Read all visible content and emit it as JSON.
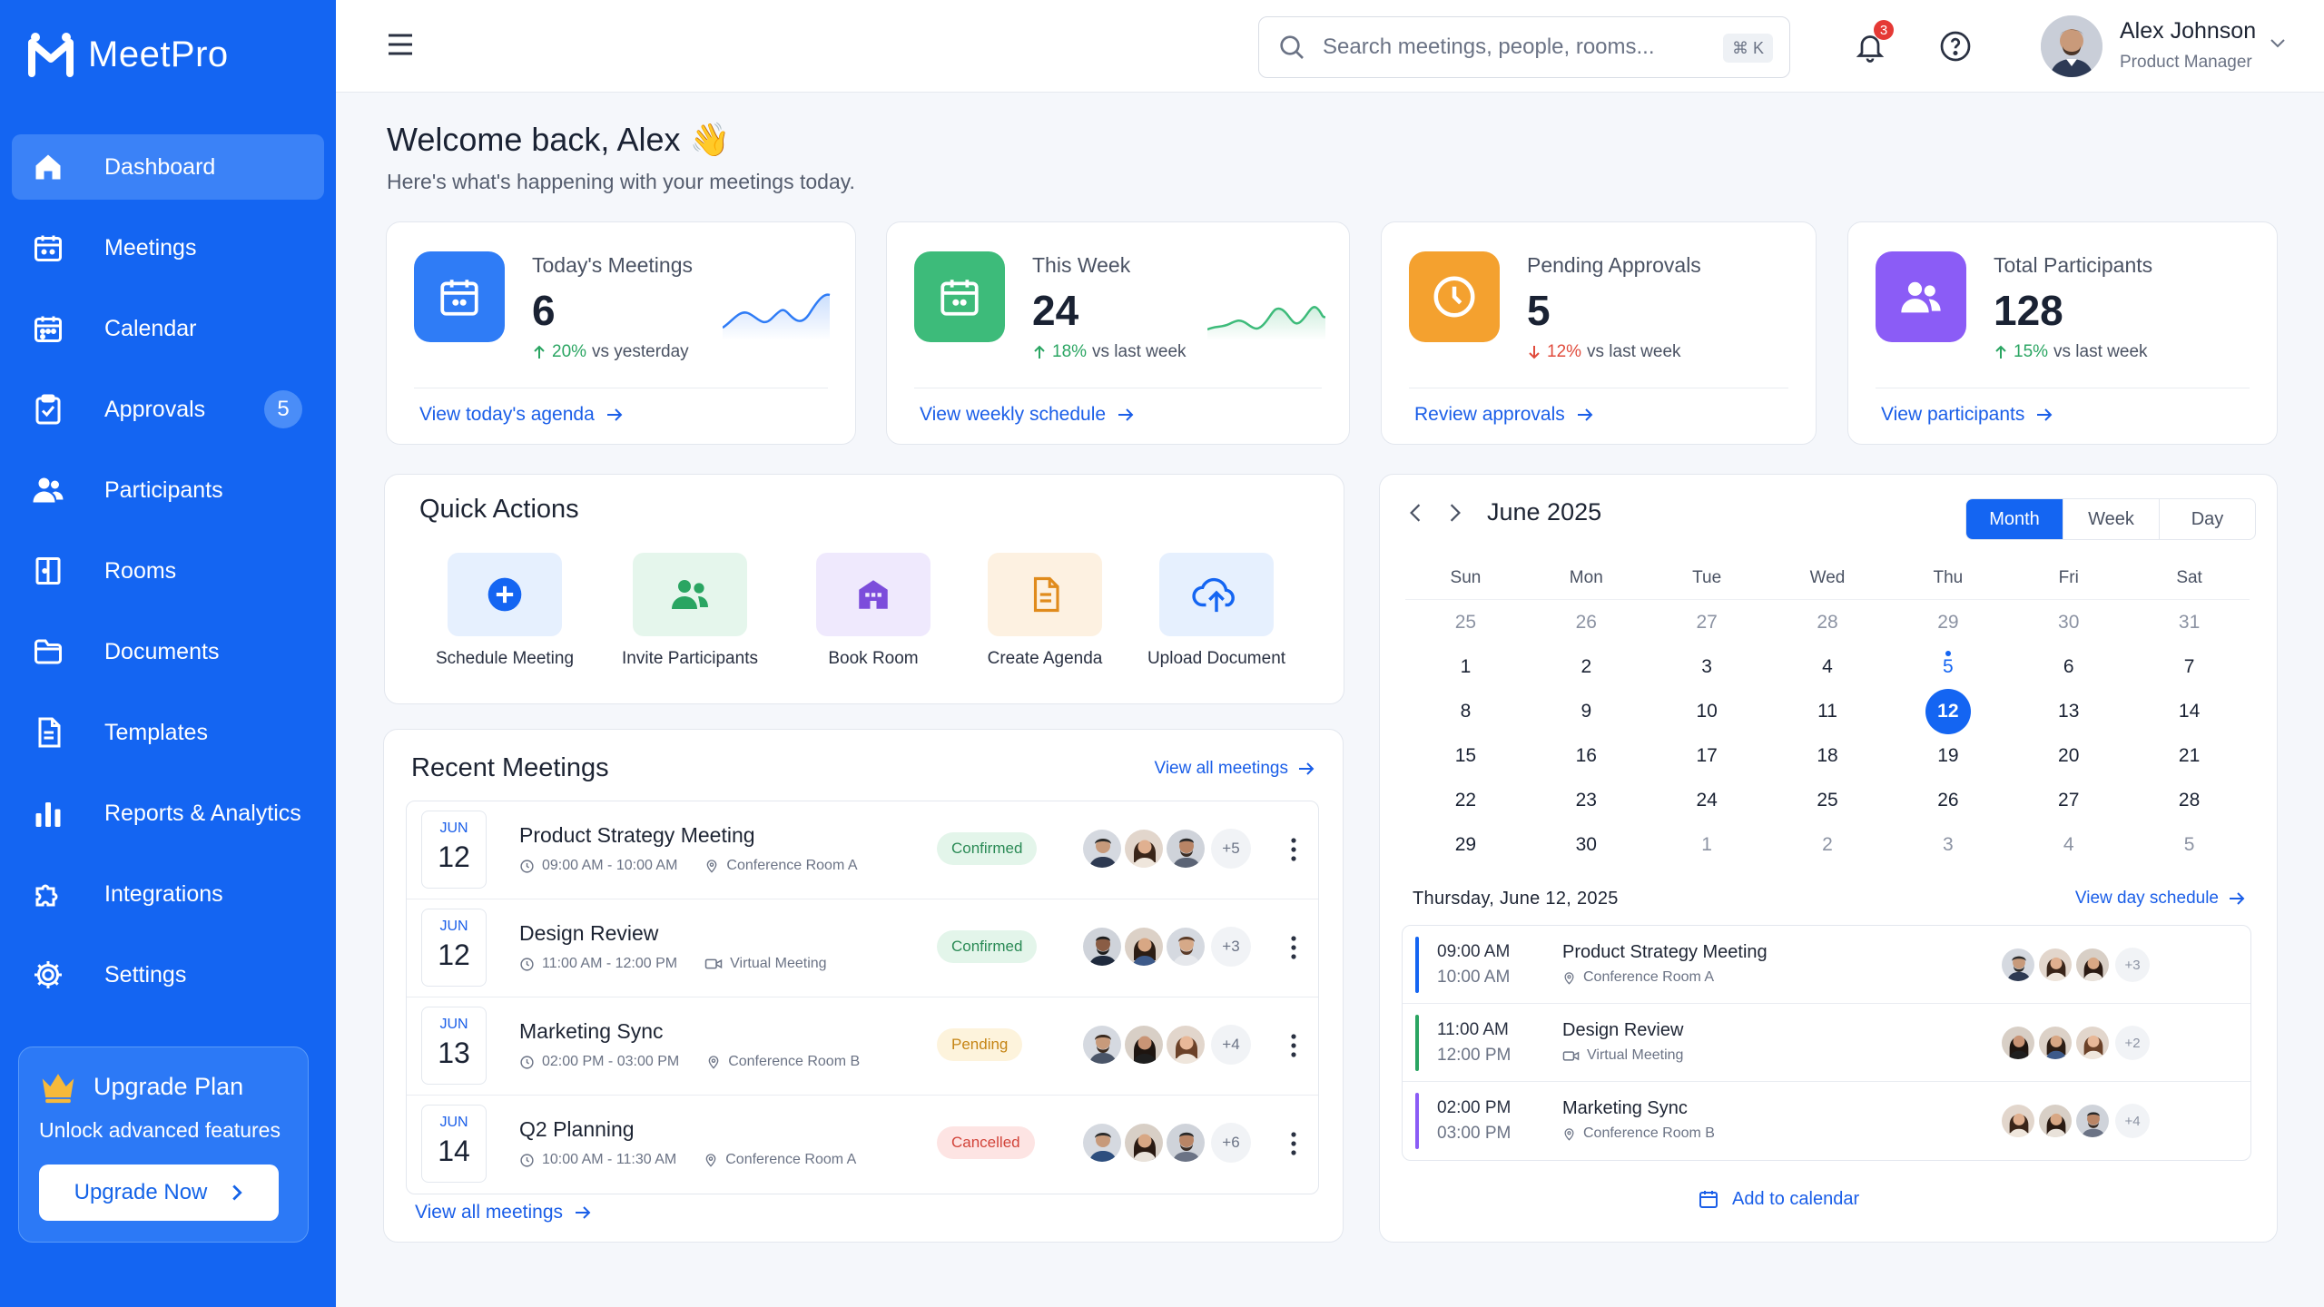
{
  "app": {
    "name": "MeetPro"
  },
  "sidebar": {
    "items": [
      {
        "label": "Dashboard",
        "icon": "home-icon",
        "active": true
      },
      {
        "label": "Meetings",
        "icon": "calendar-icon"
      },
      {
        "label": "Calendar",
        "icon": "calendar-icon"
      },
      {
        "label": "Approvals",
        "icon": "clipboard-check-icon",
        "badge": "5"
      },
      {
        "label": "Participants",
        "icon": "users-icon"
      },
      {
        "label": "Rooms",
        "icon": "door-icon"
      },
      {
        "label": "Documents",
        "icon": "folder-icon"
      },
      {
        "label": "Templates",
        "icon": "document-icon"
      },
      {
        "label": "Reports & Analytics",
        "icon": "bar-chart-icon"
      },
      {
        "label": "Integrations",
        "icon": "puzzle-icon"
      },
      {
        "label": "Settings",
        "icon": "gear-icon"
      }
    ],
    "upgrade": {
      "title": "Upgrade Plan",
      "subtitle": "Unlock advanced features",
      "button": "Upgrade Now"
    }
  },
  "topbar": {
    "search_placeholder": "Search meetings, people, rooms...",
    "shortcut": "⌘ K",
    "notifications": "3",
    "user": {
      "name": "Alex Johnson",
      "role": "Product Manager"
    }
  },
  "welcome": {
    "title": "Welcome back, Alex 👋",
    "subtitle": "Here's what's happening with your meetings today."
  },
  "stats": [
    {
      "label": "Today's Meetings",
      "value": "6",
      "change": "20%",
      "direction": "up",
      "period": "vs yesterday",
      "link": "View today's agenda",
      "color": "#2f7cf6",
      "icon": "calendar-icon"
    },
    {
      "label": "This Week",
      "value": "24",
      "change": "18%",
      "direction": "up",
      "period": "vs last week",
      "link": "View weekly schedule",
      "color": "#3dbb7a",
      "icon": "calendar-icon"
    },
    {
      "label": "Pending Approvals",
      "value": "5",
      "change": "12%",
      "direction": "down",
      "period": "vs last week",
      "link": "Review approvals",
      "color": "#f4a12f",
      "icon": "clock-icon"
    },
    {
      "label": "Total Participants",
      "value": "128",
      "change": "15%",
      "direction": "up",
      "period": "vs last week",
      "link": "View participants",
      "color": "#8b5cf6",
      "icon": "users-icon"
    }
  ],
  "quick_actions": {
    "title": "Quick Actions",
    "items": [
      {
        "label": "Schedule Meeting",
        "icon": "plus-circle-icon",
        "bg": "#e6f0fe",
        "fg": "#1465f2"
      },
      {
        "label": "Invite Participants",
        "icon": "users-icon",
        "bg": "#e5f6ec",
        "fg": "#2aa562"
      },
      {
        "label": "Book Room",
        "icon": "building-icon",
        "bg": "#efe9fd",
        "fg": "#7c4ddb"
      },
      {
        "label": "Create Agenda",
        "icon": "document-icon",
        "bg": "#fdf1e1",
        "fg": "#e08b1c"
      },
      {
        "label": "Upload Document",
        "icon": "cloud-upload-icon",
        "bg": "#e6f0fe",
        "fg": "#1465f2"
      }
    ]
  },
  "recent_meetings": {
    "title": "Recent Meetings",
    "view_all": "View all meetings",
    "footer_link": "View all meetings",
    "rows": [
      {
        "month": "JUN",
        "day": "12",
        "name": "Product Strategy Meeting",
        "time": "09:00 AM - 10:00 AM",
        "location": "Conference Room A",
        "loc_icon": "map-pin-icon",
        "status": "Confirmed",
        "more": "+5"
      },
      {
        "month": "JUN",
        "day": "12",
        "name": "Design Review",
        "time": "11:00 AM - 12:00 PM",
        "location": "Virtual Meeting",
        "loc_icon": "video-icon",
        "status": "Confirmed",
        "more": "+3"
      },
      {
        "month": "JUN",
        "day": "13",
        "name": "Marketing Sync",
        "time": "02:00 PM - 03:00 PM",
        "location": "Conference Room B",
        "loc_icon": "map-pin-icon",
        "status": "Pending",
        "more": "+4"
      },
      {
        "month": "JUN",
        "day": "14",
        "name": "Q2 Planning",
        "time": "10:00 AM - 11:30 AM",
        "location": "Conference Room A",
        "loc_icon": "map-pin-icon",
        "status": "Cancelled",
        "more": "+6"
      }
    ]
  },
  "calendar": {
    "month": "June 2025",
    "views": [
      "Month",
      "Week",
      "Day"
    ],
    "active_view": "Month",
    "weekdays": [
      "Sun",
      "Mon",
      "Tue",
      "Wed",
      "Thu",
      "Fri",
      "Sat"
    ],
    "weeks": [
      [
        "25",
        "26",
        "27",
        "28",
        "29",
        "30",
        "31"
      ],
      [
        "1",
        "2",
        "3",
        "4",
        "5",
        "6",
        "7"
      ],
      [
        "8",
        "9",
        "10",
        "11",
        "12",
        "13",
        "14"
      ],
      [
        "15",
        "16",
        "17",
        "18",
        "19",
        "20",
        "21"
      ],
      [
        "22",
        "23",
        "24",
        "25",
        "26",
        "27",
        "28"
      ],
      [
        "29",
        "30",
        "1",
        "2",
        "3",
        "4",
        "5"
      ]
    ],
    "today": "12",
    "selected_day_title": "Thursday, June 12, 2025",
    "view_day_link": "View day schedule",
    "schedule": [
      {
        "start": "09:00 AM",
        "end": "10:00 AM",
        "name": "Product Strategy Meeting",
        "location": "Conference Room A",
        "loc_icon": "map-pin-icon",
        "color": "#1465f2",
        "more": "+3"
      },
      {
        "start": "11:00 AM",
        "end": "12:00 PM",
        "name": "Design Review",
        "location": "Virtual Meeting",
        "loc_icon": "video-icon",
        "color": "#2aa562",
        "more": "+2"
      },
      {
        "start": "02:00 PM",
        "end": "03:00 PM",
        "name": "Marketing Sync",
        "location": "Conference Room B",
        "loc_icon": "map-pin-icon",
        "color": "#8b5cf6",
        "more": "+4"
      }
    ],
    "add_link": "Add to calendar"
  }
}
